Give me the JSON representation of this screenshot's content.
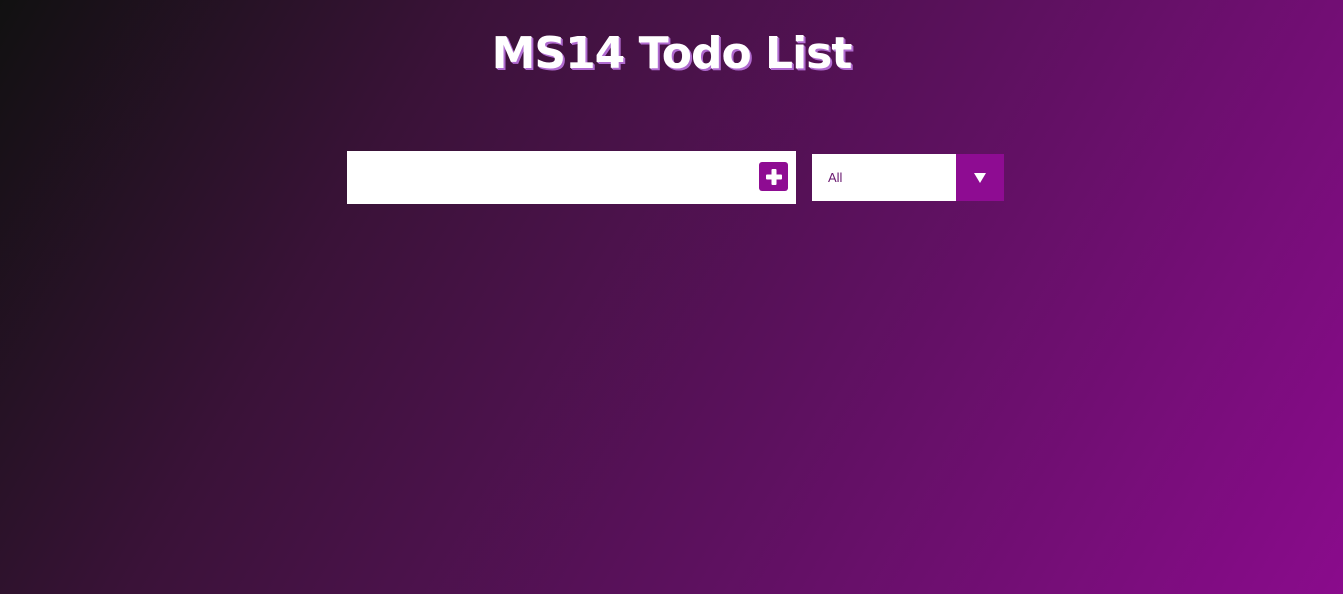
{
  "header": {
    "title": "MS14 Todo List"
  },
  "form": {
    "input_value": "",
    "input_placeholder": "",
    "add_icon": "plus-square-icon",
    "filter": {
      "selected": "All",
      "arrow_icon": "caret-down-icon"
    }
  },
  "todos": [],
  "colors": {
    "accent": "#8e0c92",
    "text_on_white": "#6a1a70"
  }
}
